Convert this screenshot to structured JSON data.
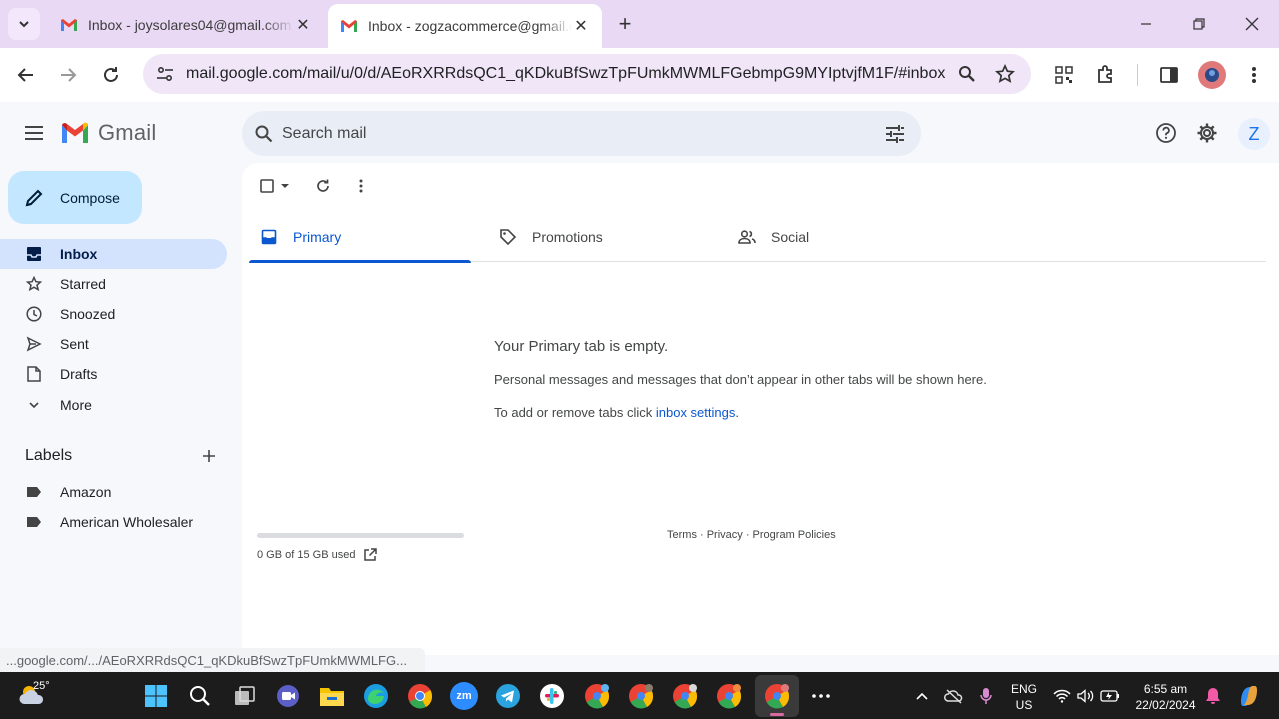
{
  "browser": {
    "tabs": [
      {
        "title": "Inbox - joysolares04@gmail.com",
        "active": false
      },
      {
        "title": "Inbox - zogzacommerce@gmail.com",
        "active": true
      }
    ],
    "url": "mail.google.com/mail/u/0/d/AEoRXRRdsQC1_qKDkuBfSwzTpFUmkMWMLFGebmpG9MYIptvjfM1F/#inbox",
    "status_url": "...google.com/.../AEoRXRRdsQC1_qKDkuBfSwzTpFUmkMWMLFG..."
  },
  "header": {
    "logo_text": "Gmail",
    "search_placeholder": "Search mail",
    "account_initial": "Z"
  },
  "sidebar": {
    "compose_label": "Compose",
    "nav": [
      {
        "label": "Inbox",
        "icon": "inbox-icon",
        "active": true
      },
      {
        "label": "Starred",
        "icon": "star-icon"
      },
      {
        "label": "Snoozed",
        "icon": "clock-icon"
      },
      {
        "label": "Sent",
        "icon": "send-icon"
      },
      {
        "label": "Drafts",
        "icon": "draft-icon"
      },
      {
        "label": "More",
        "icon": "chevron-down-icon"
      }
    ],
    "labels_title": "Labels",
    "labels": [
      {
        "label": "Amazon"
      },
      {
        "label": "American Wholesaler"
      }
    ]
  },
  "main": {
    "tabs": [
      {
        "label": "Primary",
        "icon": "inbox-icon",
        "active": true
      },
      {
        "label": "Promotions",
        "icon": "tag-icon"
      },
      {
        "label": "Social",
        "icon": "people-icon"
      }
    ],
    "empty_title": "Your Primary tab is empty.",
    "empty_desc": "Personal messages and messages that don’t appear in other tabs will be shown here.",
    "settings_prefix": "To add or remove tabs click ",
    "settings_link": "inbox settings",
    "settings_suffix": ".",
    "storage_text": "0 GB of 15 GB used",
    "storage_used_fraction": 0,
    "footer": "Terms · Privacy · Program Policies"
  },
  "taskbar": {
    "temperature": "25°",
    "language_line1": "ENG",
    "language_line2": "US",
    "time": "6:55 am",
    "date": "22/02/2024"
  }
}
